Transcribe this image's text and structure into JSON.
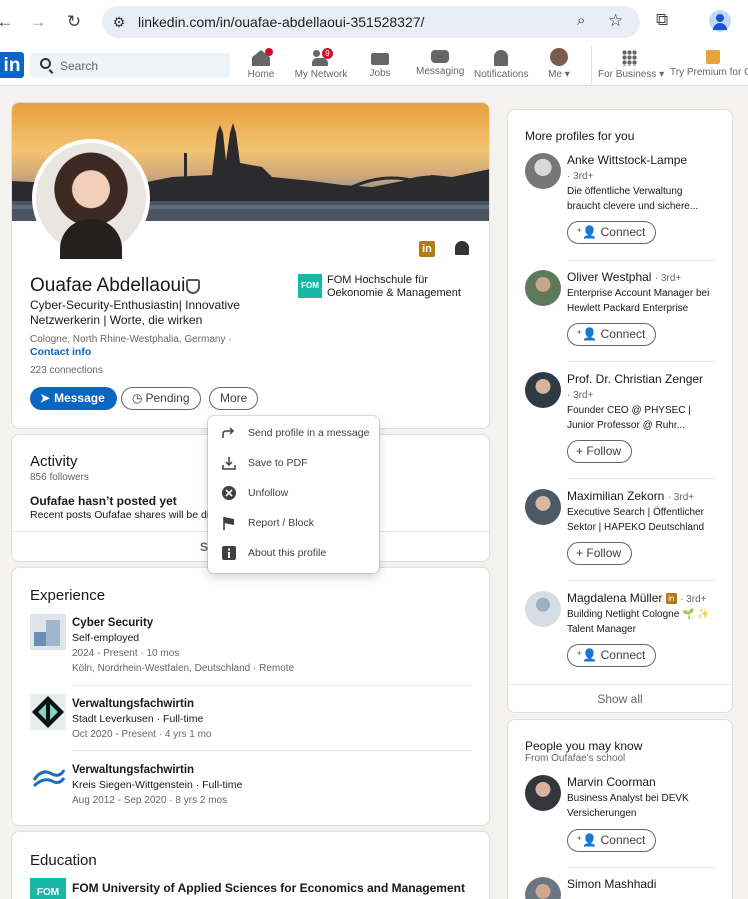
{
  "browser": {
    "url": "linkedin.com/in/ouafae-abdellaoui-351528327/"
  },
  "header": {
    "logo": "in",
    "search_placeholder": "Search",
    "nav": [
      {
        "label": "Home",
        "icon": "home-icon",
        "badge": ""
      },
      {
        "label": "My Network",
        "icon": "network-icon",
        "badge": "9"
      },
      {
        "label": "Jobs",
        "icon": "briefcase-icon",
        "badge": ""
      },
      {
        "label": "Messaging",
        "icon": "chat-icon",
        "badge": ""
      },
      {
        "label": "Notifications",
        "icon": "bell-icon",
        "badge": ""
      },
      {
        "label": "Me ▾",
        "icon": "avatar-icon",
        "badge": ""
      },
      {
        "label": "For Business ▾",
        "icon": "grid-icon",
        "badge": ""
      },
      {
        "label": "Try Premium for CH",
        "icon": "premium-icon",
        "badge": ""
      }
    ]
  },
  "profile": {
    "name": "Ouafae Abdellaoui",
    "headline": "Cyber-Security-Enthusiastin| Innovative Netzwerkerin | Worte, die wirken",
    "location": "Cologne, North Rhine-Westphalia, Germany ·",
    "contact_info": "Contact info",
    "connections": "223 connections",
    "org_logo": "FOM",
    "org_name": "FOM Hochschule für Oekonomie & Management",
    "buttons": {
      "message": "Message",
      "pending": "Pending",
      "more": "More"
    }
  },
  "more_menu": [
    {
      "label": "Send profile in a message",
      "icon": "share-arrow-icon"
    },
    {
      "label": "Save to PDF",
      "icon": "download-icon"
    },
    {
      "label": "Unfollow",
      "icon": "unfollow-icon"
    },
    {
      "label": "Report / Block",
      "icon": "flag-icon"
    },
    {
      "label": "About this profile",
      "icon": "info-icon"
    }
  ],
  "activity": {
    "title": "Activity",
    "followers": "856 followers",
    "empty_title": "Oufafae hasn’t posted yet",
    "empty_sub": "Recent posts Oufafae shares will be disp",
    "show": "Sh"
  },
  "experience": {
    "title": "Experience",
    "items": [
      {
        "title": "Cyber Security",
        "company": "Self-employed",
        "dates": "2024 - Present · 10 mos",
        "location": "Köln, Nordrhein-Westfalen, Deutschland · Remote"
      },
      {
        "title": "Verwaltungsfachwirtin",
        "company": "Stadt Leverkusen · Full-time",
        "dates": "Oct 2020 - Present · 4 yrs 1 mo",
        "location": ""
      },
      {
        "title": "Verwaltungsfachwirtin",
        "company": "Kreis Siegen-Wittgenstein · Full-time",
        "dates": "Aug 2012 - Sep 2020 · 8 yrs 2 mos",
        "location": ""
      }
    ]
  },
  "education": {
    "title": "Education",
    "logo": "FOM",
    "items": [
      {
        "school": "FOM University of Applied Sciences for Economics and Management"
      }
    ]
  },
  "more_profiles": {
    "title": "More profiles for you",
    "people": [
      {
        "name": "Anke Wittstock-Lampe",
        "degree": "",
        "sub1": "· 3rd+",
        "sub2": "Die öffentliche Verwaltung braucht clevere und sichere...",
        "action": "Connect"
      },
      {
        "name": "Oliver Westphal",
        "degree": "· 3rd+",
        "sub1": "Enterprise Account Manager bei Hewlett Packard Enterprise",
        "sub2": "",
        "action": "Connect"
      },
      {
        "name": "Prof. Dr. Christian Zenger",
        "degree": "",
        "sub1": "· 3rd+",
        "sub2": "Founder CEO @ PHYSEC | Junior Professor @ Ruhr...",
        "action": "Follow"
      },
      {
        "name": "Maximilian Zekorn",
        "degree": "· 3rd+",
        "sub1": "Executive Search | Öffentlicher Sektor | HAPEKO Deutschland",
        "sub2": "",
        "action": "Follow"
      },
      {
        "name": "Magdalena Müller",
        "degree": "· 3rd+",
        "sub1": "Building Netlight Cologne 🌱 ✨ Talent Manager",
        "sub2": "",
        "action": "Connect"
      }
    ],
    "show_all": "Show all"
  },
  "people_know": {
    "title": "People you may know",
    "subtitle": "From Oufafae's school",
    "people": [
      {
        "name": "Marvin Coorman",
        "sub1": "Business Analyst bei DEVK Versicherungen",
        "action": "Connect"
      },
      {
        "name": "Simon Mashhadi",
        "sub1": "",
        "action": ""
      }
    ]
  },
  "colors": {
    "brand": "#0a66c2",
    "page_bg": "#f4f2ee",
    "badge": "#cb112d"
  }
}
